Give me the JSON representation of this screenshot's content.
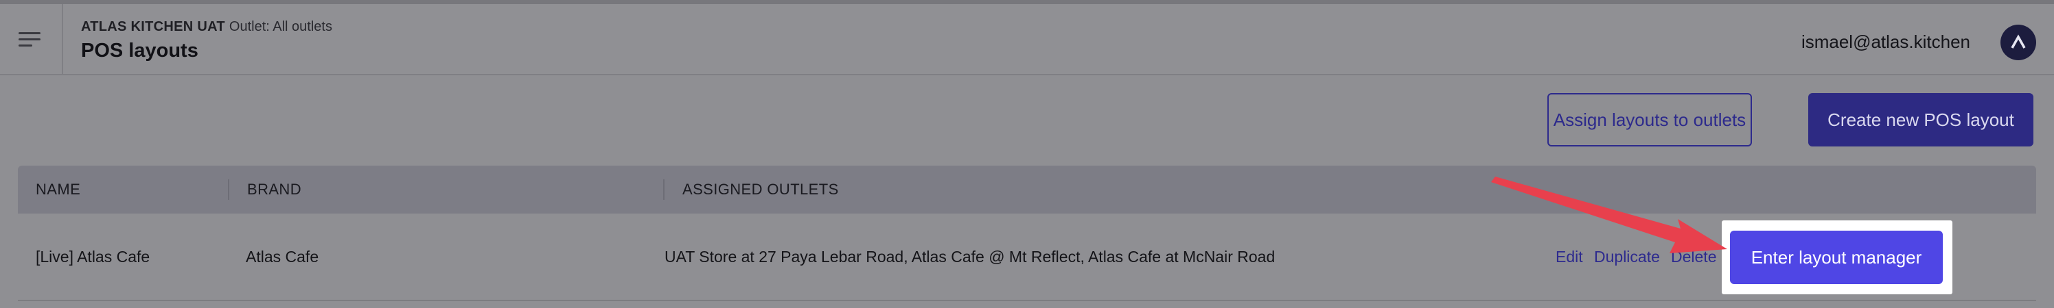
{
  "header": {
    "org_name": "ATLAS KITCHEN UAT",
    "outlet_label": "Outlet: All outlets",
    "page_title": "POS layouts",
    "user_email": "ismael@atlas.kitchen",
    "avatar_icon": "atlas-logo-icon",
    "menu_icon": "menu-icon"
  },
  "actions": {
    "assign_label": "Assign layouts to outlets",
    "create_label": "Create new POS layout"
  },
  "table": {
    "columns": [
      "NAME",
      "BRAND",
      "ASSIGNED OUTLETS"
    ],
    "rows": [
      {
        "name": "[Live] Atlas Cafe",
        "brand": "Atlas Cafe",
        "outlets": "UAT Store at 27 Paya Lebar Road, Atlas Cafe @ Mt Reflect, Atlas Cafe at McNair Road",
        "actions": [
          "Edit",
          "Duplicate",
          "Delete"
        ],
        "primary_action": "Enter layout manager"
      }
    ]
  },
  "colors": {
    "brand_primary": "#4f46e5",
    "annotation_arrow": "#e8404d"
  }
}
